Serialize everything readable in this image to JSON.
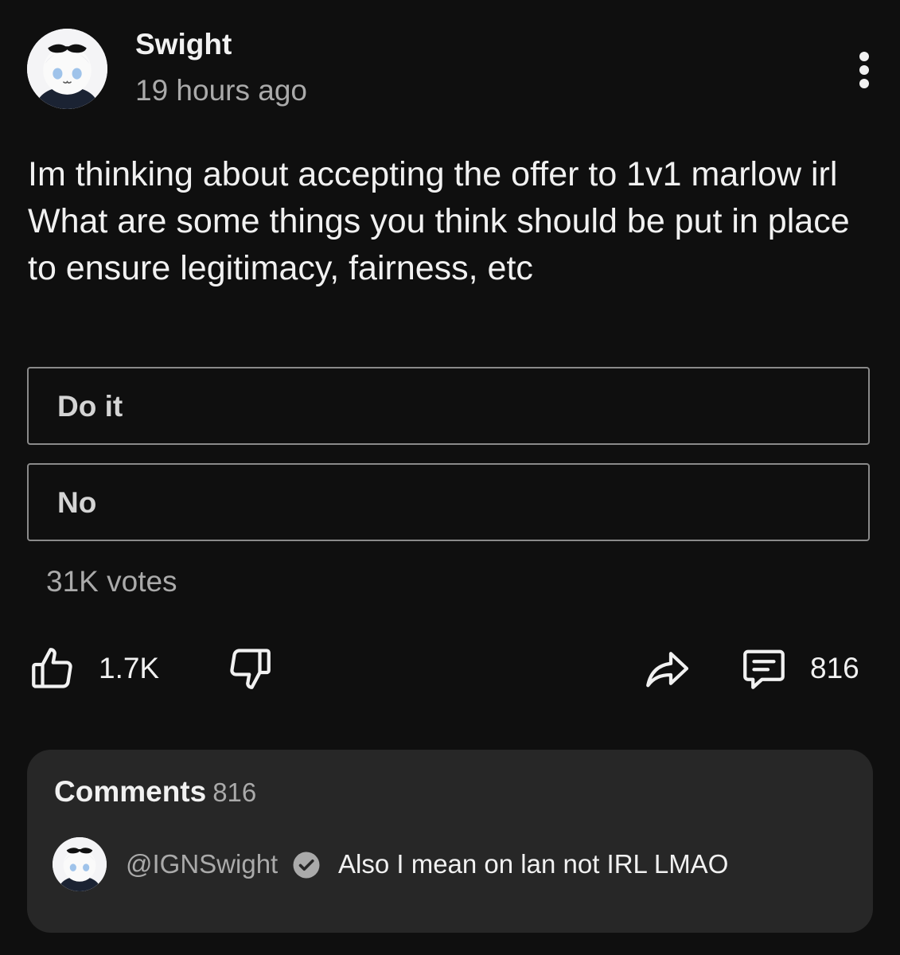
{
  "post": {
    "author": "Swight",
    "timestamp": "19 hours ago",
    "text_lines": [
      "Im thinking about accepting the offer to 1v1 marlow irl",
      "What are some things you think should be put in place to ensure legitimacy, fairness, etc"
    ]
  },
  "poll": {
    "options": [
      "Do it",
      "No"
    ],
    "votes": "31K votes"
  },
  "actions": {
    "like_count": "1.7K",
    "comment_count": "816",
    "icons": [
      "thumbs-up-icon",
      "thumbs-down-icon",
      "share-icon",
      "comment-icon"
    ]
  },
  "comments": {
    "title": "Comments",
    "count": "816",
    "top_comment": {
      "handle": "@IGNSwight",
      "verified": true,
      "text": "Also I mean on lan not IRL LMAO"
    }
  },
  "colors": {
    "background": "#0f0f0f",
    "card": "#272727",
    "text_primary": "#f1f1f1",
    "text_secondary": "#aaaaaa",
    "poll_border": "#8a8a8a"
  }
}
